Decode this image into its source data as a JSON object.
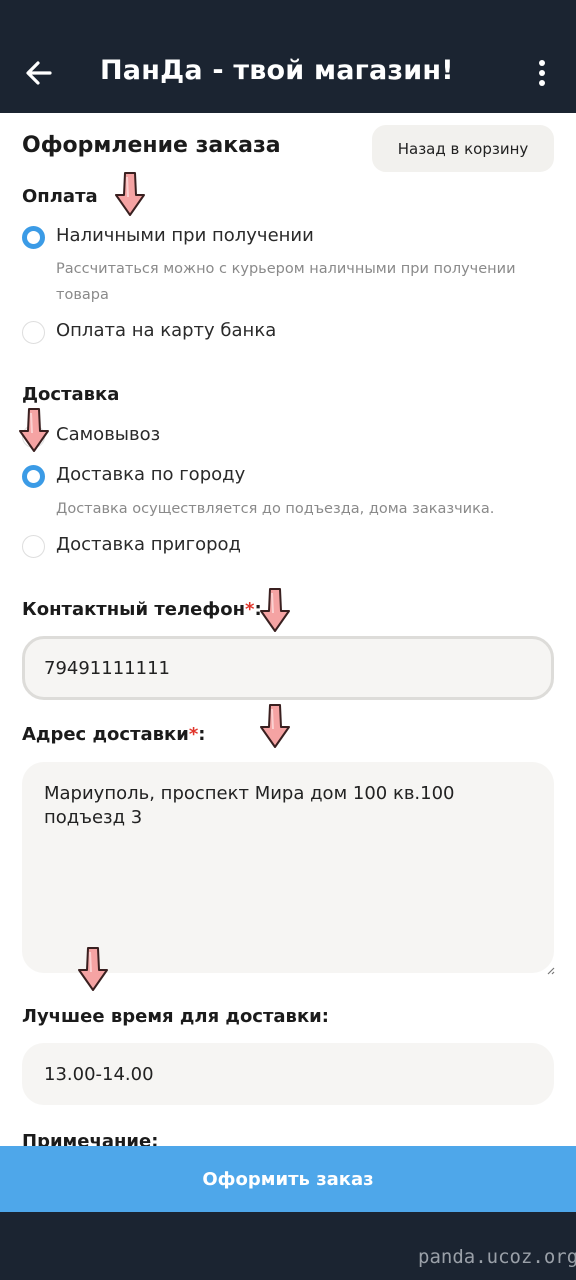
{
  "app_bar": {
    "title": "ПанДа - твой магазин!",
    "back_icon": "arrow-left-icon",
    "menu_icon": "more-vertical-icon",
    "background": "#1b2431"
  },
  "page": {
    "title": "Оформление заказа",
    "back_to_cart_label": "Назад в корзину"
  },
  "payment": {
    "title": "Оплата",
    "options": [
      {
        "label": "Наличными при получении",
        "checked": true,
        "description": "Рассчитаться можно с курьером наличными при получении товара"
      },
      {
        "label": "Оплата на карту банка",
        "checked": false
      }
    ]
  },
  "delivery": {
    "title": "Доставка",
    "options": [
      {
        "label": "Самовывоз",
        "checked": false
      },
      {
        "label": "Доставка по городу",
        "checked": true,
        "description": "Доставка осуществляется до подъезда, дома заказчика."
      },
      {
        "label": "Доставка пригород",
        "checked": false
      }
    ]
  },
  "form": {
    "phone": {
      "label": "Контактный телефон",
      "required_mark": "*",
      "suffix": ":",
      "value": "79491111111"
    },
    "address": {
      "label": "Адрес доставки",
      "required_mark": "*",
      "suffix": ":",
      "value": "Мариуполь, проспект Мира дом 100 кв.100 подъезд 3"
    },
    "best_time": {
      "label": "Лучшее время для доставки:",
      "value": "13.00-14.00"
    },
    "note": {
      "label": "Примечание:"
    }
  },
  "submit_label": "Оформить заказ",
  "watermark": "panda.ucoz.org",
  "colors": {
    "accent": "#3b9be6",
    "submit": "#4ea7ea",
    "required": "#e0352b",
    "annotation_arrow": "#f5a3a3"
  }
}
